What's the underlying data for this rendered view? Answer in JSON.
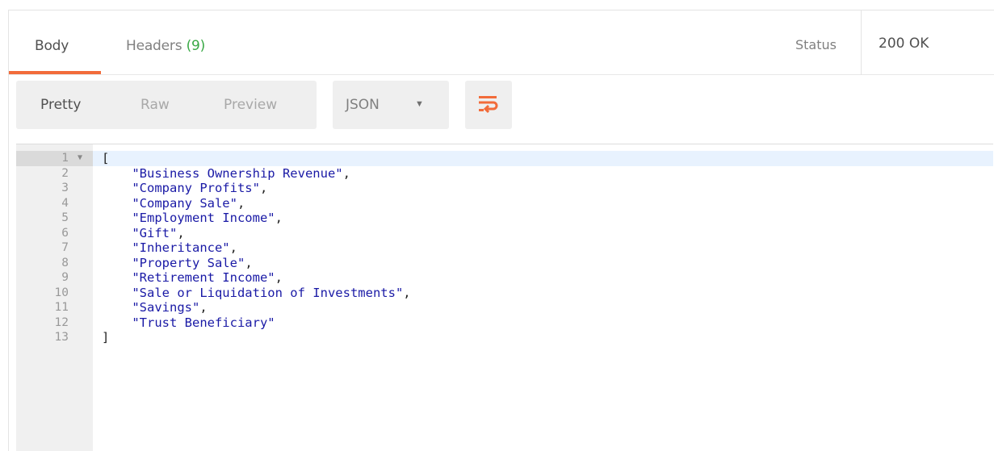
{
  "tabs": {
    "body_label": "Body",
    "headers_label": "Headers",
    "headers_count": "(9)"
  },
  "status": {
    "label": "Status",
    "value": "200 OK"
  },
  "toolbar": {
    "modes": [
      "Pretty",
      "Raw",
      "Preview"
    ],
    "active_mode": "Pretty",
    "format": "JSON",
    "wrap_icon": "wrap-lines-icon"
  },
  "colors": {
    "accent": "#f26b3a",
    "count_green": "#3aa946",
    "string_blue": "#1a1aa6",
    "active_line": "#e8f2fe"
  },
  "editor": {
    "open_bracket": "[",
    "close_bracket": "]",
    "items": [
      "\"Business Ownership Revenue\"",
      "\"Company Profits\"",
      "\"Company Sale\"",
      "\"Employment Income\"",
      "\"Gift\"",
      "\"Inheritance\"",
      "\"Property Sale\"",
      "\"Retirement Income\"",
      "\"Sale or Liquidation of Investments\"",
      "\"Savings\"",
      "\"Trust Beneficiary\""
    ],
    "line_numbers": [
      "1",
      "2",
      "3",
      "4",
      "5",
      "6",
      "7",
      "8",
      "9",
      "10",
      "11",
      "12",
      "13"
    ]
  }
}
